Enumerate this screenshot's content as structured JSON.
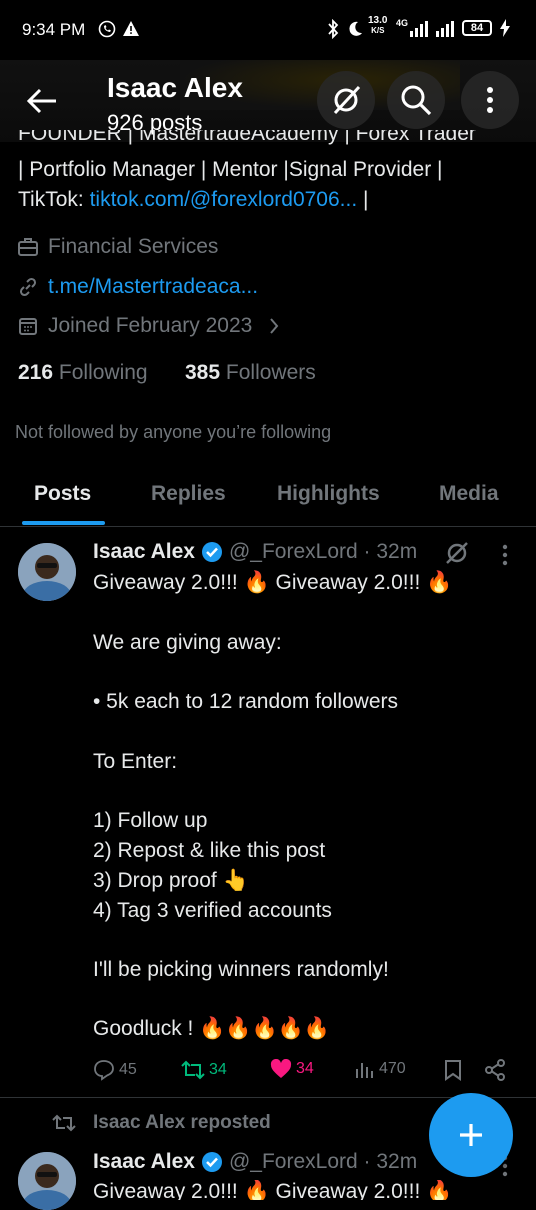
{
  "status_bar": {
    "time": "9:34 PM",
    "net_speed": "13.0",
    "net_unit": "K/S",
    "net_type": "4G",
    "battery": "84"
  },
  "header": {
    "name": "Isaac Alex",
    "posts": "926 posts"
  },
  "bio": {
    "line1": "FOUNDER | MastertradeAcademy | Forex Trader",
    "line2": "| Portfolio Manager | Mentor |Signal Provider |",
    "line3_prefix": "TikTok: ",
    "line3_link": "tiktok.com/@forexlord0706...",
    "line3_suffix": " |"
  },
  "details": {
    "category": "Financial Services",
    "website": "t.me/Mastertradeaca...",
    "joined": "Joined February 2023"
  },
  "stats": {
    "following_count": "216",
    "following_label": "Following",
    "followers_count": "385",
    "followers_label": "Followers"
  },
  "followed_by": "Not followed by anyone you’re following",
  "tabs": [
    {
      "label": "Posts",
      "active": true
    },
    {
      "label": "Replies",
      "active": false
    },
    {
      "label": "Highlights",
      "active": false
    },
    {
      "label": "Media",
      "active": false
    }
  ],
  "post": {
    "name": "Isaac Alex",
    "handle_time": "@_ForexLord · 32m",
    "lines": [
      "Giveaway 2.0!!! 🔥 Giveaway 2.0!!! 🔥",
      "We are giving away:",
      "• 5k each to 12 random followers",
      "To Enter:",
      "1) Follow up",
      "2) Repost & like this post",
      "3) Drop proof 👆",
      "4) Tag 3 verified accounts",
      "I'll be picking winners randomly!",
      "Goodluck ! 🔥🔥🔥🔥🔥"
    ],
    "replies": "45",
    "reposts": "34",
    "likes": "34",
    "views": "470"
  },
  "repost": {
    "label": "Isaac Alex reposted",
    "name": "Isaac Alex",
    "handle_time": "@_ForexLord · 32m",
    "text": "Giveaway 2.0!!! 🔥 Giveaway 2.0!!! 🔥"
  },
  "colors": {
    "accent": "#1d9bf0",
    "repost_green": "#00ba7c",
    "like_pink": "#f91880",
    "muted": "#71767b"
  }
}
